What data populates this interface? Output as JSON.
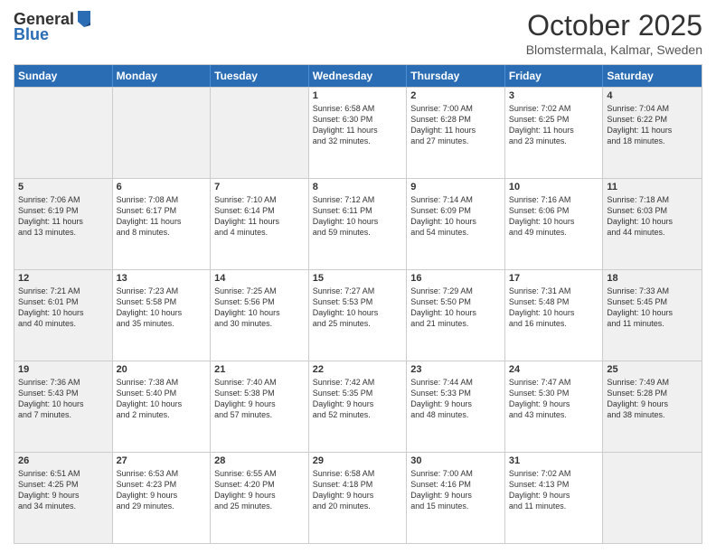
{
  "header": {
    "logo_line1": "General",
    "logo_line2": "Blue",
    "month": "October 2025",
    "location": "Blomstermala, Kalmar, Sweden"
  },
  "days_of_week": [
    "Sunday",
    "Monday",
    "Tuesday",
    "Wednesday",
    "Thursday",
    "Friday",
    "Saturday"
  ],
  "weeks": [
    [
      {
        "day": "",
        "info": "",
        "shaded": true
      },
      {
        "day": "",
        "info": "",
        "shaded": true
      },
      {
        "day": "",
        "info": "",
        "shaded": true
      },
      {
        "day": "1",
        "info": "Sunrise: 6:58 AM\nSunset: 6:30 PM\nDaylight: 11 hours\nand 32 minutes.",
        "shaded": false
      },
      {
        "day": "2",
        "info": "Sunrise: 7:00 AM\nSunset: 6:28 PM\nDaylight: 11 hours\nand 27 minutes.",
        "shaded": false
      },
      {
        "day": "3",
        "info": "Sunrise: 7:02 AM\nSunset: 6:25 PM\nDaylight: 11 hours\nand 23 minutes.",
        "shaded": false
      },
      {
        "day": "4",
        "info": "Sunrise: 7:04 AM\nSunset: 6:22 PM\nDaylight: 11 hours\nand 18 minutes.",
        "shaded": true
      }
    ],
    [
      {
        "day": "5",
        "info": "Sunrise: 7:06 AM\nSunset: 6:19 PM\nDaylight: 11 hours\nand 13 minutes.",
        "shaded": true
      },
      {
        "day": "6",
        "info": "Sunrise: 7:08 AM\nSunset: 6:17 PM\nDaylight: 11 hours\nand 8 minutes.",
        "shaded": false
      },
      {
        "day": "7",
        "info": "Sunrise: 7:10 AM\nSunset: 6:14 PM\nDaylight: 11 hours\nand 4 minutes.",
        "shaded": false
      },
      {
        "day": "8",
        "info": "Sunrise: 7:12 AM\nSunset: 6:11 PM\nDaylight: 10 hours\nand 59 minutes.",
        "shaded": false
      },
      {
        "day": "9",
        "info": "Sunrise: 7:14 AM\nSunset: 6:09 PM\nDaylight: 10 hours\nand 54 minutes.",
        "shaded": false
      },
      {
        "day": "10",
        "info": "Sunrise: 7:16 AM\nSunset: 6:06 PM\nDaylight: 10 hours\nand 49 minutes.",
        "shaded": false
      },
      {
        "day": "11",
        "info": "Sunrise: 7:18 AM\nSunset: 6:03 PM\nDaylight: 10 hours\nand 44 minutes.",
        "shaded": true
      }
    ],
    [
      {
        "day": "12",
        "info": "Sunrise: 7:21 AM\nSunset: 6:01 PM\nDaylight: 10 hours\nand 40 minutes.",
        "shaded": true
      },
      {
        "day": "13",
        "info": "Sunrise: 7:23 AM\nSunset: 5:58 PM\nDaylight: 10 hours\nand 35 minutes.",
        "shaded": false
      },
      {
        "day": "14",
        "info": "Sunrise: 7:25 AM\nSunset: 5:56 PM\nDaylight: 10 hours\nand 30 minutes.",
        "shaded": false
      },
      {
        "day": "15",
        "info": "Sunrise: 7:27 AM\nSunset: 5:53 PM\nDaylight: 10 hours\nand 25 minutes.",
        "shaded": false
      },
      {
        "day": "16",
        "info": "Sunrise: 7:29 AM\nSunset: 5:50 PM\nDaylight: 10 hours\nand 21 minutes.",
        "shaded": false
      },
      {
        "day": "17",
        "info": "Sunrise: 7:31 AM\nSunset: 5:48 PM\nDaylight: 10 hours\nand 16 minutes.",
        "shaded": false
      },
      {
        "day": "18",
        "info": "Sunrise: 7:33 AM\nSunset: 5:45 PM\nDaylight: 10 hours\nand 11 minutes.",
        "shaded": true
      }
    ],
    [
      {
        "day": "19",
        "info": "Sunrise: 7:36 AM\nSunset: 5:43 PM\nDaylight: 10 hours\nand 7 minutes.",
        "shaded": true
      },
      {
        "day": "20",
        "info": "Sunrise: 7:38 AM\nSunset: 5:40 PM\nDaylight: 10 hours\nand 2 minutes.",
        "shaded": false
      },
      {
        "day": "21",
        "info": "Sunrise: 7:40 AM\nSunset: 5:38 PM\nDaylight: 9 hours\nand 57 minutes.",
        "shaded": false
      },
      {
        "day": "22",
        "info": "Sunrise: 7:42 AM\nSunset: 5:35 PM\nDaylight: 9 hours\nand 52 minutes.",
        "shaded": false
      },
      {
        "day": "23",
        "info": "Sunrise: 7:44 AM\nSunset: 5:33 PM\nDaylight: 9 hours\nand 48 minutes.",
        "shaded": false
      },
      {
        "day": "24",
        "info": "Sunrise: 7:47 AM\nSunset: 5:30 PM\nDaylight: 9 hours\nand 43 minutes.",
        "shaded": false
      },
      {
        "day": "25",
        "info": "Sunrise: 7:49 AM\nSunset: 5:28 PM\nDaylight: 9 hours\nand 38 minutes.",
        "shaded": true
      }
    ],
    [
      {
        "day": "26",
        "info": "Sunrise: 6:51 AM\nSunset: 4:25 PM\nDaylight: 9 hours\nand 34 minutes.",
        "shaded": true
      },
      {
        "day": "27",
        "info": "Sunrise: 6:53 AM\nSunset: 4:23 PM\nDaylight: 9 hours\nand 29 minutes.",
        "shaded": false
      },
      {
        "day": "28",
        "info": "Sunrise: 6:55 AM\nSunset: 4:20 PM\nDaylight: 9 hours\nand 25 minutes.",
        "shaded": false
      },
      {
        "day": "29",
        "info": "Sunrise: 6:58 AM\nSunset: 4:18 PM\nDaylight: 9 hours\nand 20 minutes.",
        "shaded": false
      },
      {
        "day": "30",
        "info": "Sunrise: 7:00 AM\nSunset: 4:16 PM\nDaylight: 9 hours\nand 15 minutes.",
        "shaded": false
      },
      {
        "day": "31",
        "info": "Sunrise: 7:02 AM\nSunset: 4:13 PM\nDaylight: 9 hours\nand 11 minutes.",
        "shaded": false
      },
      {
        "day": "",
        "info": "",
        "shaded": true
      }
    ]
  ]
}
